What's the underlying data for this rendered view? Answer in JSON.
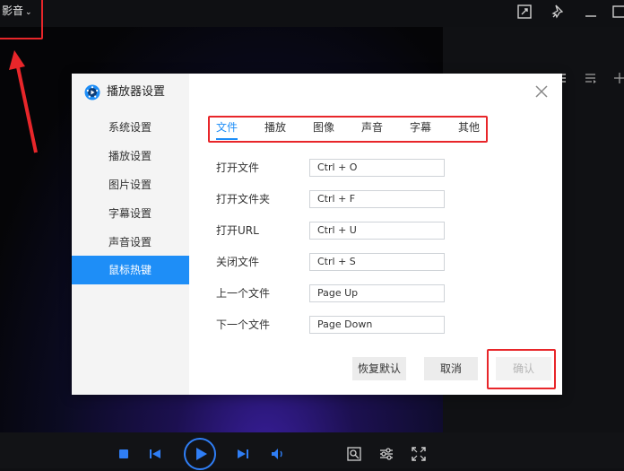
{
  "app_menu": {
    "label": "影音"
  },
  "dialog": {
    "title": "播放器设置",
    "sidebar": [
      {
        "label": "系统设置",
        "active": false
      },
      {
        "label": "播放设置",
        "active": false
      },
      {
        "label": "图片设置",
        "active": false
      },
      {
        "label": "字幕设置",
        "active": false
      },
      {
        "label": "声音设置",
        "active": false
      },
      {
        "label": "鼠标热键",
        "active": true
      }
    ],
    "tabs": [
      {
        "label": "文件",
        "active": true
      },
      {
        "label": "播放",
        "active": false
      },
      {
        "label": "图像",
        "active": false
      },
      {
        "label": "声音",
        "active": false
      },
      {
        "label": "字幕",
        "active": false
      },
      {
        "label": "其他",
        "active": false
      }
    ],
    "hotkeys": [
      {
        "label": "打开文件",
        "value": "Ctrl + O"
      },
      {
        "label": "打开文件夹",
        "value": "Ctrl + F"
      },
      {
        "label": "打开URL",
        "value": "Ctrl + U"
      },
      {
        "label": "关闭文件",
        "value": "Ctrl + S"
      },
      {
        "label": "上一个文件",
        "value": "Page Up"
      },
      {
        "label": "下一个文件",
        "value": "Page Down"
      }
    ],
    "buttons": {
      "restore_default": "恢复默认",
      "cancel": "取消",
      "confirm": "确认"
    }
  },
  "colors": {
    "accent": "#1e8ef7",
    "highlight": "#e8262a",
    "player_blue": "#2f7ef5"
  }
}
